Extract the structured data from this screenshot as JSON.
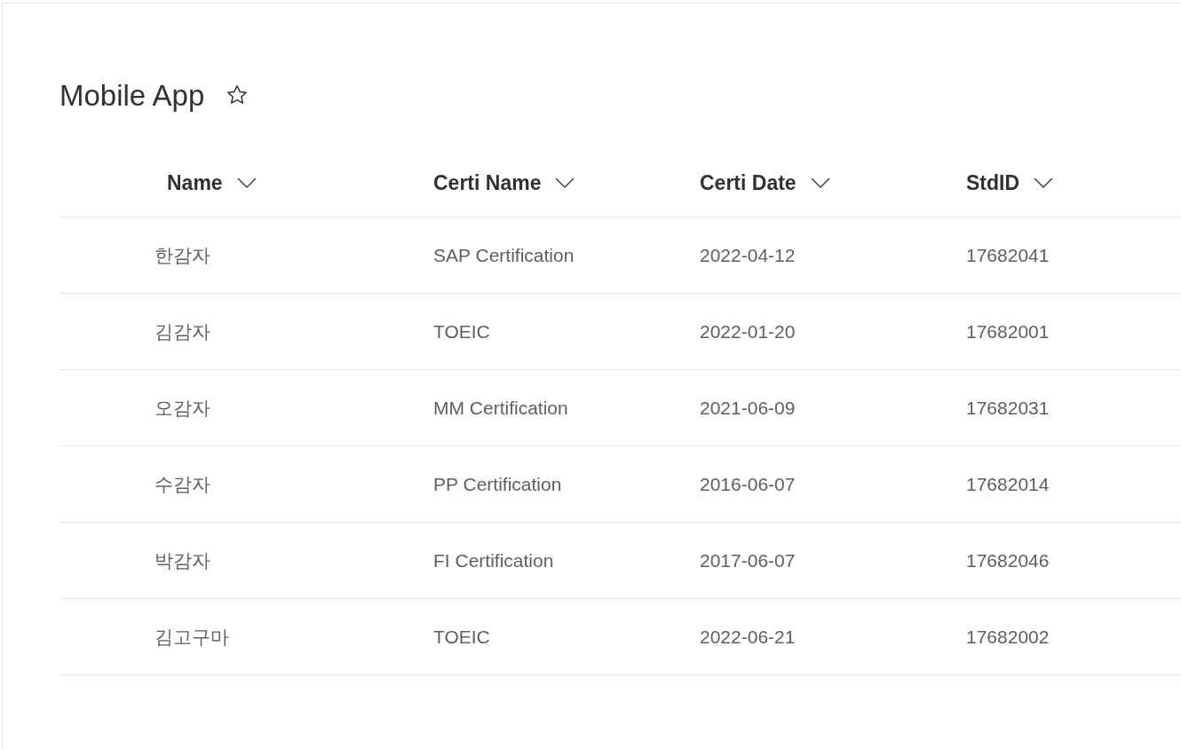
{
  "page": {
    "title": "Mobile App",
    "starred": false
  },
  "table": {
    "columns": [
      {
        "label": "Name"
      },
      {
        "label": "Certi Name"
      },
      {
        "label": "Certi Date"
      },
      {
        "label": "StdID"
      }
    ],
    "rows": [
      [
        "한감자",
        "SAP Certification",
        "2022-04-12",
        "17682041"
      ],
      [
        "김감자",
        "TOEIC",
        "2022-01-20",
        "17682001"
      ],
      [
        "오감자",
        "MM Certification",
        "2021-06-09",
        "17682031"
      ],
      [
        "수감자",
        "PP Certification",
        "2016-06-07",
        "17682014"
      ],
      [
        "박감자",
        "FI Certification",
        "2017-06-07",
        "17682046"
      ],
      [
        "김고구마",
        "TOEIC",
        "2022-06-21",
        "17682002"
      ]
    ]
  }
}
